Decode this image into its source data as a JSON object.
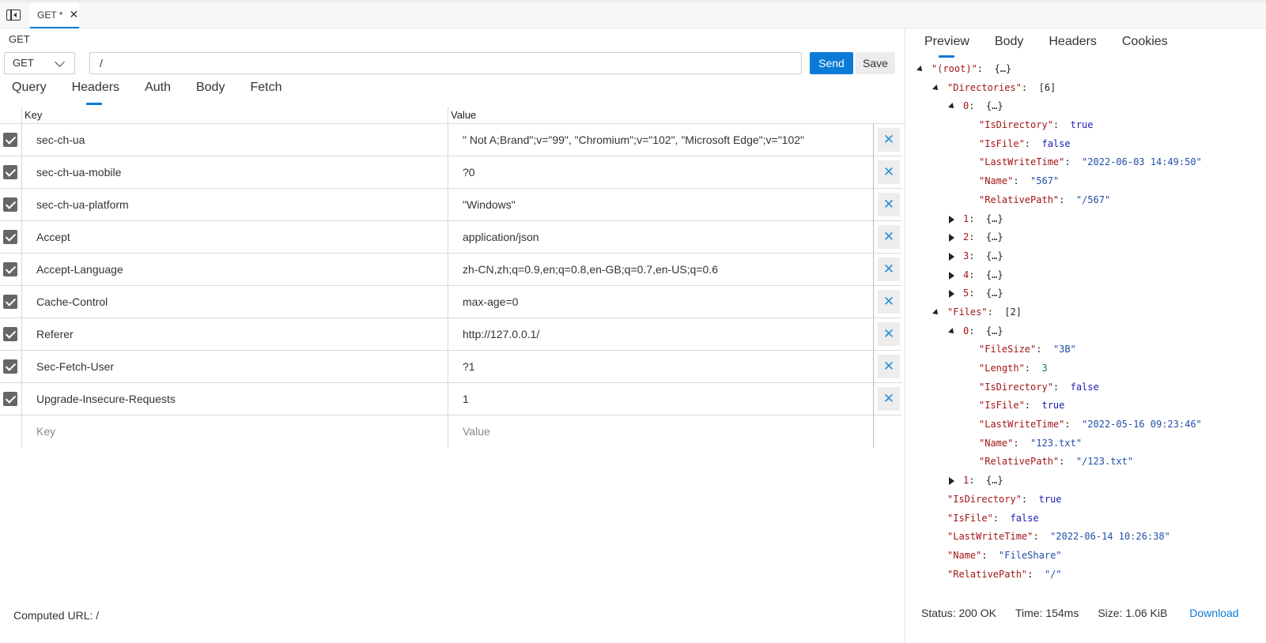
{
  "tabstrip": {
    "tab_label": "GET *",
    "tab_close": "✕"
  },
  "request": {
    "method_label": "GET",
    "method_value": "GET",
    "url": "/",
    "send_label": "Send",
    "save_label": "Save",
    "tabs": [
      "Query",
      "Headers",
      "Auth",
      "Body",
      "Fetch"
    ],
    "active_tab": "Headers",
    "table": {
      "key_header": "Key",
      "value_header": "Value",
      "rows": [
        {
          "key": "sec-ch-ua",
          "value": "\" Not A;Brand\";v=\"99\", \"Chromium\";v=\"102\", \"Microsoft Edge\";v=\"102\""
        },
        {
          "key": "sec-ch-ua-mobile",
          "value": "?0"
        },
        {
          "key": "sec-ch-ua-platform",
          "value": "\"Windows\""
        },
        {
          "key": "Accept",
          "value": "application/json"
        },
        {
          "key": "Accept-Language",
          "value": "zh-CN,zh;q=0.9,en;q=0.8,en-GB;q=0.7,en-US;q=0.6"
        },
        {
          "key": "Cache-Control",
          "value": "max-age=0"
        },
        {
          "key": "Referer",
          "value": "http://127.0.0.1/"
        },
        {
          "key": "Sec-Fetch-User",
          "value": "?1"
        },
        {
          "key": "Upgrade-Insecure-Requests",
          "value": "1"
        }
      ],
      "key_placeholder": "Key",
      "value_placeholder": "Value",
      "delete_glyph": "✕"
    },
    "computed_url": "Computed URL: /"
  },
  "response": {
    "tabs": [
      "Preview",
      "Body",
      "Headers",
      "Cookies"
    ],
    "active_tab": "Preview",
    "tree": [
      {
        "indent": 0,
        "arrow": "open",
        "key": "\"(root)\"",
        "value": "{…}",
        "type": "brace"
      },
      {
        "indent": 1,
        "arrow": "open",
        "key": "\"Directories\"",
        "value": "[6]",
        "type": "brace"
      },
      {
        "indent": 2,
        "arrow": "open",
        "key": "0",
        "value": "{…}",
        "type": "brace"
      },
      {
        "indent": 3,
        "arrow": "none",
        "key": "\"IsDirectory\"",
        "value": "true",
        "type": "bool"
      },
      {
        "indent": 3,
        "arrow": "none",
        "key": "\"IsFile\"",
        "value": "false",
        "type": "bool"
      },
      {
        "indent": 3,
        "arrow": "none",
        "key": "\"LastWriteTime\"",
        "value": "\"2022-06-03 14:49:50\"",
        "type": "str"
      },
      {
        "indent": 3,
        "arrow": "none",
        "key": "\"Name\"",
        "value": "\"567\"",
        "type": "str"
      },
      {
        "indent": 3,
        "arrow": "none",
        "key": "\"RelativePath\"",
        "value": "\"/567\"",
        "type": "str"
      },
      {
        "indent": 2,
        "arrow": "closed",
        "key": "1",
        "value": "{…}",
        "type": "brace"
      },
      {
        "indent": 2,
        "arrow": "closed",
        "key": "2",
        "value": "{…}",
        "type": "brace"
      },
      {
        "indent": 2,
        "arrow": "closed",
        "key": "3",
        "value": "{…}",
        "type": "brace"
      },
      {
        "indent": 2,
        "arrow": "closed",
        "key": "4",
        "value": "{…}",
        "type": "brace"
      },
      {
        "indent": 2,
        "arrow": "closed",
        "key": "5",
        "value": "{…}",
        "type": "brace"
      },
      {
        "indent": 1,
        "arrow": "open",
        "key": "\"Files\"",
        "value": "[2]",
        "type": "brace"
      },
      {
        "indent": 2,
        "arrow": "open",
        "key": "0",
        "value": "{…}",
        "type": "brace"
      },
      {
        "indent": 3,
        "arrow": "none",
        "key": "\"FileSize\"",
        "value": "\"3B\"",
        "type": "str"
      },
      {
        "indent": 3,
        "arrow": "none",
        "key": "\"Length\"",
        "value": "3",
        "type": "num"
      },
      {
        "indent": 3,
        "arrow": "none",
        "key": "\"IsDirectory\"",
        "value": "false",
        "type": "bool"
      },
      {
        "indent": 3,
        "arrow": "none",
        "key": "\"IsFile\"",
        "value": "true",
        "type": "bool"
      },
      {
        "indent": 3,
        "arrow": "none",
        "key": "\"LastWriteTime\"",
        "value": "\"2022-05-16 09:23:46\"",
        "type": "str"
      },
      {
        "indent": 3,
        "arrow": "none",
        "key": "\"Name\"",
        "value": "\"123.txt\"",
        "type": "str"
      },
      {
        "indent": 3,
        "arrow": "none",
        "key": "\"RelativePath\"",
        "value": "\"/123.txt\"",
        "type": "str"
      },
      {
        "indent": 2,
        "arrow": "closed",
        "key": "1",
        "value": "{…}",
        "type": "brace"
      },
      {
        "indent": 1,
        "arrow": "none",
        "key": "\"IsDirectory\"",
        "value": "true",
        "type": "bool"
      },
      {
        "indent": 1,
        "arrow": "none",
        "key": "\"IsFile\"",
        "value": "false",
        "type": "bool"
      },
      {
        "indent": 1,
        "arrow": "none",
        "key": "\"LastWriteTime\"",
        "value": "\"2022-06-14 10:26:38\"",
        "type": "str"
      },
      {
        "indent": 1,
        "arrow": "none",
        "key": "\"Name\"",
        "value": "\"FileShare\"",
        "type": "str"
      },
      {
        "indent": 1,
        "arrow": "none",
        "key": "\"RelativePath\"",
        "value": "\"/\"",
        "type": "str"
      }
    ],
    "status": "Status: 200 OK",
    "time": "Time: 154ms",
    "size": "Size: 1.06 KiB",
    "download_label": "Download"
  },
  "colors": {
    "accent": "#0a7bd6",
    "json_key": "#a31515",
    "json_bool": "#1a1ab8",
    "json_string": "#1f4fa8",
    "json_number": "#098658"
  },
  "icons": [
    "sidebar-toggle-icon",
    "close-icon",
    "chevron-down-icon",
    "checkbox-checked-icon",
    "delete-icon",
    "expand-arrow-icon",
    "collapse-arrow-icon"
  ]
}
